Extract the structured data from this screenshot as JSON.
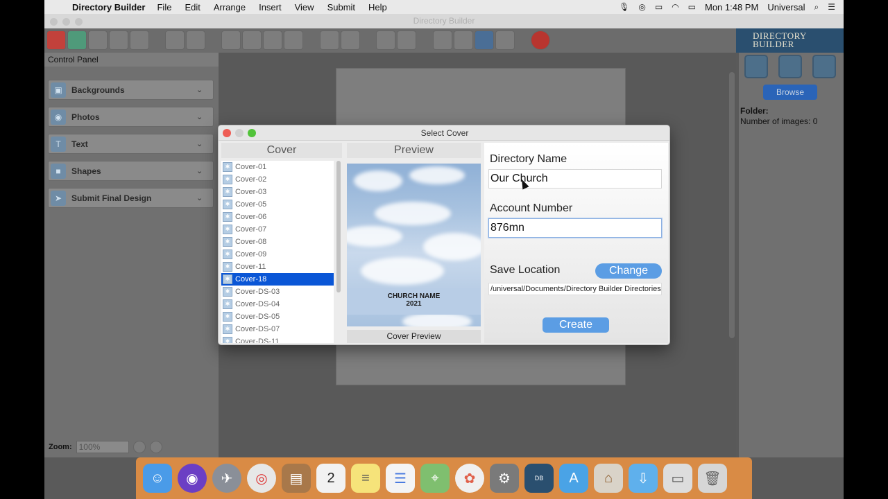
{
  "menubar": {
    "app_name": "Directory Builder",
    "items": [
      "File",
      "Edit",
      "Arrange",
      "Insert",
      "View",
      "Submit",
      "Help"
    ],
    "clock": "Mon 1:48 PM",
    "user": "Universal"
  },
  "window": {
    "title": "Directory Builder"
  },
  "logo": {
    "line1": "DIRECTORY",
    "line2": "BUILDER"
  },
  "control_panel": {
    "header": "Control Panel",
    "items": [
      {
        "label": "Backgrounds",
        "icon": "image-icon"
      },
      {
        "label": "Photos",
        "icon": "camera-icon"
      },
      {
        "label": "Text",
        "icon": "text-icon"
      },
      {
        "label": "Shapes",
        "icon": "shapes-icon"
      },
      {
        "label": "Submit Final Design",
        "icon": "submit-icon"
      }
    ],
    "zoom_label": "Zoom:",
    "zoom_value": "100%"
  },
  "right_panel": {
    "browse_label": "Browse",
    "folder_label": "Folder:",
    "images_count": "Number of images: 0"
  },
  "dialog": {
    "title": "Select Cover",
    "cover_header": "Cover",
    "preview_header": "Preview",
    "covers": [
      "Cover-01",
      "Cover-02",
      "Cover-03",
      "Cover-05",
      "Cover-06",
      "Cover-07",
      "Cover-08",
      "Cover-09",
      "Cover-11",
      "Cover-18",
      "Cover-DS-03",
      "Cover-DS-04",
      "Cover-DS-05",
      "Cover-DS-07",
      "Cover-DS-11"
    ],
    "selected_cover": "Cover-18",
    "preview_church_name": "CHURCH NAME",
    "preview_year": "2021",
    "preview_caption": "Cover Preview",
    "directory_name_label": "Directory Name",
    "directory_name_value": "Our Church",
    "account_number_label": "Account Number",
    "account_number_value": "876mn",
    "save_location_label": "Save Location",
    "change_label": "Change",
    "save_path": "/universal/Documents/Directory Builder Directories",
    "create_label": "Create"
  },
  "colors": {
    "selection": "#0a56d6",
    "accent_button": "#5b9de4",
    "browse_button": "#2a64b8",
    "logo_bg": "#2a4f6f"
  }
}
